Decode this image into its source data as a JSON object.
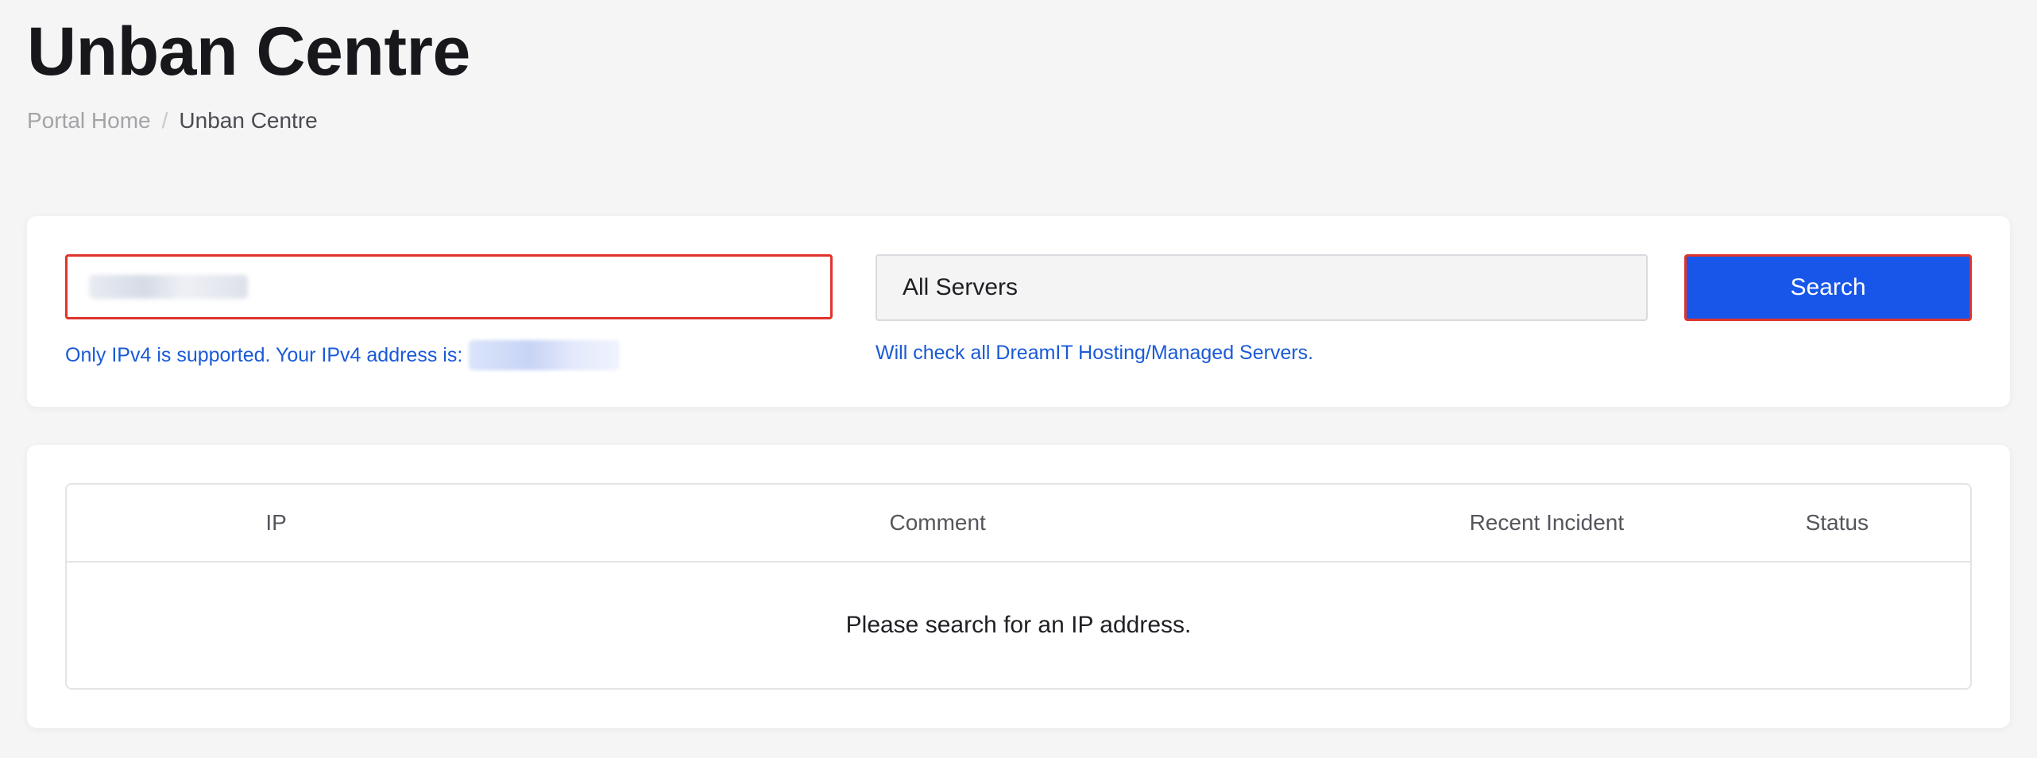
{
  "page": {
    "title": "Unban Centre"
  },
  "breadcrumb": {
    "home": "Portal Home",
    "separator": "/",
    "current": "Unban Centre"
  },
  "search": {
    "ip_input": {
      "value": "",
      "placeholder": ""
    },
    "ip_help": "Only IPv4 is supported. Your IPv4 address is:",
    "server_select": {
      "selected": "All Servers"
    },
    "server_help": "Will check all DreamIT Hosting/Managed Servers.",
    "button_label": "Search"
  },
  "results": {
    "columns": [
      "IP",
      "Comment",
      "Recent Incident",
      "Status"
    ],
    "empty_message": "Please search for an IP address."
  },
  "colors": {
    "background": "#f5f5f5",
    "accent": "#1856ea",
    "help_text": "#1a5ad7",
    "highlight_border": "#e0342b"
  }
}
